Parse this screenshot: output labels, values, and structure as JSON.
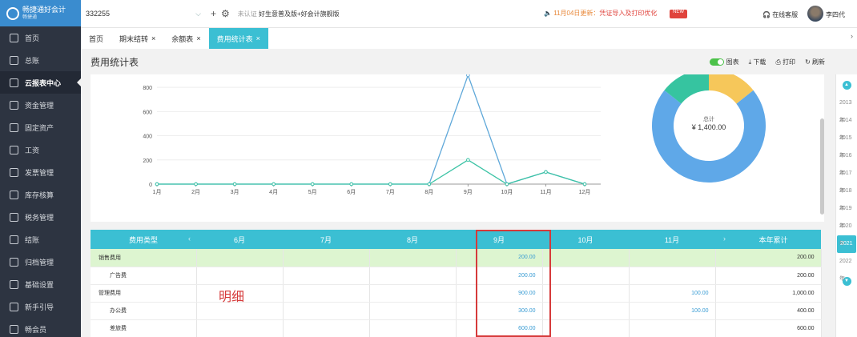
{
  "sidebar": {
    "brand": "畅捷通好会计",
    "brand_sub": "畅捷通",
    "items": [
      {
        "label": "首页",
        "icon": "home-icon"
      },
      {
        "label": "总账",
        "icon": "ledger-icon"
      },
      {
        "label": "云报表中心",
        "icon": "report-icon"
      },
      {
        "label": "资金管理",
        "icon": "fund-icon"
      },
      {
        "label": "固定资产",
        "icon": "asset-icon"
      },
      {
        "label": "工资",
        "icon": "salary-icon"
      },
      {
        "label": "发票管理",
        "icon": "invoice-icon"
      },
      {
        "label": "库存核算",
        "icon": "inventory-icon"
      },
      {
        "label": "税务管理",
        "icon": "tax-icon"
      },
      {
        "label": "结账",
        "icon": "close-book-icon"
      },
      {
        "label": "归档管理",
        "icon": "archive-icon"
      },
      {
        "label": "基础设置",
        "icon": "settings-icon"
      },
      {
        "label": "新手引导",
        "icon": "guide-icon"
      },
      {
        "label": "畅会员",
        "icon": "vip-icon"
      }
    ]
  },
  "topbar": {
    "account": "332255",
    "edition_tag": "未认证",
    "edition": "好生意普及版+好会计旗舰版",
    "notice": "11月04日更新：",
    "notice_highlight": "凭证导入及打印优化",
    "badge": "NEW",
    "service": "在线客服",
    "user": "李四代"
  },
  "tabs": [
    {
      "label": "首页",
      "closable": false,
      "active": false
    },
    {
      "label": "期末结转",
      "closable": true,
      "active": false
    },
    {
      "label": "余额表",
      "closable": true,
      "active": false
    },
    {
      "label": "费用统计表",
      "closable": true,
      "active": true
    }
  ],
  "page": {
    "title": "费用统计表",
    "toolbar": {
      "chart": "图表",
      "download": "下载",
      "print": "打印",
      "refresh": "刷新"
    }
  },
  "chart_data": [
    {
      "type": "line",
      "categories": [
        "1月",
        "2月",
        "3月",
        "4月",
        "5月",
        "6月",
        "7月",
        "8月",
        "9月",
        "10月",
        "11月",
        "12月"
      ],
      "ylim": [
        0,
        900
      ],
      "yticks": [
        0,
        200,
        400,
        600,
        800
      ],
      "series": [
        {
          "values": [
            0,
            0,
            0,
            0,
            0,
            0,
            0,
            0,
            900,
            0,
            100,
            0
          ],
          "color": "#5fa8d9"
        },
        {
          "values": [
            0,
            0,
            0,
            0,
            0,
            0,
            0,
            0,
            200,
            0,
            100,
            0
          ],
          "color": "#3cc3a5"
        }
      ],
      "grid": true
    },
    {
      "type": "pie",
      "donut": true,
      "center_label": "总计",
      "center_value": "¥ 1,400.00",
      "slices": [
        {
          "value": 1000,
          "color": "#5fa8e8"
        },
        {
          "value": 200,
          "color": "#36c4a0"
        },
        {
          "value": 200,
          "color": "#f6c75a"
        }
      ]
    }
  ],
  "table": {
    "headers": [
      "费用类型",
      "6月",
      "7月",
      "8月",
      "9月",
      "10月",
      "11月",
      "本年累计"
    ],
    "rows": [
      {
        "name": "销售费用",
        "sub": false,
        "highlight": true,
        "cells": [
          "",
          "",
          "",
          "200.00",
          "",
          "",
          "200.00"
        ]
      },
      {
        "name": "广告费",
        "sub": true,
        "highlight": false,
        "cells": [
          "",
          "",
          "",
          "200.00",
          "",
          "",
          "200.00"
        ]
      },
      {
        "name": "管理费用",
        "sub": false,
        "highlight": false,
        "cells": [
          "",
          "",
          "",
          "900.00",
          "",
          "100.00",
          "1,000.00"
        ]
      },
      {
        "name": "办公费",
        "sub": true,
        "highlight": false,
        "cells": [
          "",
          "",
          "",
          "300.00",
          "",
          "100.00",
          "400.00"
        ]
      },
      {
        "name": "差旅费",
        "sub": true,
        "highlight": false,
        "cells": [
          "",
          "",
          "",
          "600.00",
          "",
          "",
          "600.00"
        ]
      }
    ]
  },
  "annotation": "明细",
  "years": [
    "2013年",
    "2014年",
    "2015年",
    "2016年",
    "2017年",
    "2018年",
    "2019年",
    "2020年",
    "2021年",
    "2022年"
  ],
  "active_year": "2021年"
}
